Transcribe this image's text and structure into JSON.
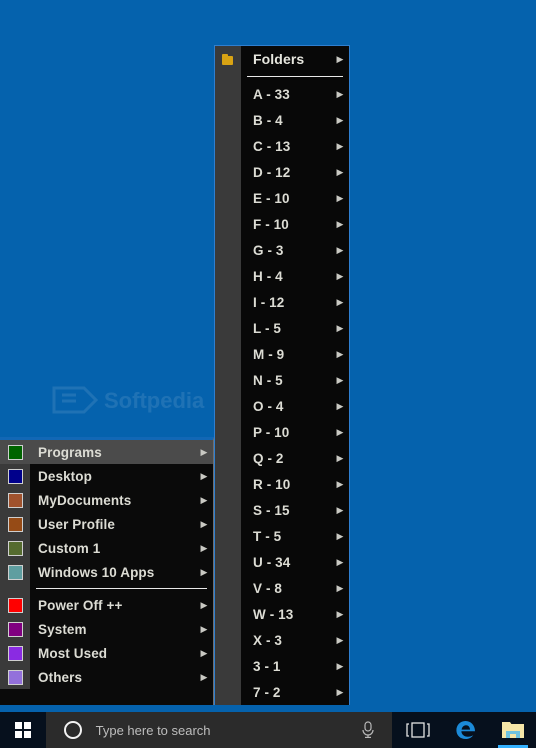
{
  "desktop": {
    "background_color": "#0562ad",
    "watermark_alt": "softpedia-watermark"
  },
  "main_menu": {
    "selected_index": 0,
    "items": [
      {
        "label": "Programs",
        "color": "#006400",
        "has_submenu": true,
        "selected": true
      },
      {
        "label": "Desktop",
        "color": "#00008b",
        "has_submenu": true,
        "selected": false
      },
      {
        "label": "MyDocuments",
        "color": "#a0522d",
        "has_submenu": true,
        "selected": false
      },
      {
        "label": "User Profile",
        "color": "#964b16",
        "has_submenu": true,
        "selected": false
      },
      {
        "label": "Custom 1",
        "color": "#556b2f",
        "has_submenu": true,
        "selected": false
      },
      {
        "label": "Windows 10 Apps",
        "color": "#5f9ea0",
        "has_submenu": true,
        "selected": false
      },
      {
        "separator": true
      },
      {
        "label": "Power Off ++",
        "color": "#ff0000",
        "has_submenu": true,
        "selected": false
      },
      {
        "label": "System",
        "color": "#800080",
        "has_submenu": true,
        "selected": false
      },
      {
        "label": "Most Used",
        "color": "#8a2be2",
        "has_submenu": true,
        "selected": false
      },
      {
        "label": "Others",
        "color": "#9370db",
        "has_submenu": true,
        "selected": false
      }
    ]
  },
  "folders_menu": {
    "header": {
      "label": "Folders",
      "icon": "folder-icon",
      "has_submenu": true
    },
    "items": [
      {
        "label": "A - 33",
        "has_submenu": true
      },
      {
        "label": "B - 4",
        "has_submenu": true
      },
      {
        "label": "C - 13",
        "has_submenu": true
      },
      {
        "label": "D - 12",
        "has_submenu": true
      },
      {
        "label": "E - 10",
        "has_submenu": true
      },
      {
        "label": "F - 10",
        "has_submenu": true
      },
      {
        "label": "G - 3",
        "has_submenu": true
      },
      {
        "label": "H - 4",
        "has_submenu": true
      },
      {
        "label": "I - 12",
        "has_submenu": true
      },
      {
        "label": "L - 5",
        "has_submenu": true
      },
      {
        "label": "M - 9",
        "has_submenu": true
      },
      {
        "label": "N - 5",
        "has_submenu": true
      },
      {
        "label": "O - 4",
        "has_submenu": true
      },
      {
        "label": "P - 10",
        "has_submenu": true
      },
      {
        "label": "Q - 2",
        "has_submenu": true
      },
      {
        "label": "R - 10",
        "has_submenu": true
      },
      {
        "label": "S - 15",
        "has_submenu": true
      },
      {
        "label": "T - 5",
        "has_submenu": true
      },
      {
        "label": "U - 34",
        "has_submenu": true
      },
      {
        "label": "V - 8",
        "has_submenu": true
      },
      {
        "label": "W - 13",
        "has_submenu": true
      },
      {
        "label": "X - 3",
        "has_submenu": true
      },
      {
        "label": "3 - 1",
        "has_submenu": true
      },
      {
        "label": "7 - 2",
        "has_submenu": true
      }
    ]
  },
  "taskbar": {
    "start_button": {
      "name": "start-button",
      "icon": "windows-logo-icon"
    },
    "search": {
      "placeholder": "Type here to search",
      "value": "",
      "cortana_icon": "cortana-circle-icon",
      "mic_icon": "microphone-icon"
    },
    "icons": [
      {
        "name": "task-view-icon",
        "label": "Task View",
        "active": false
      },
      {
        "name": "edge-icon",
        "label": "Microsoft Edge",
        "active": false
      },
      {
        "name": "file-explorer-icon",
        "label": "File Explorer",
        "active": true
      }
    ],
    "accent_color": "#33b1ff"
  }
}
